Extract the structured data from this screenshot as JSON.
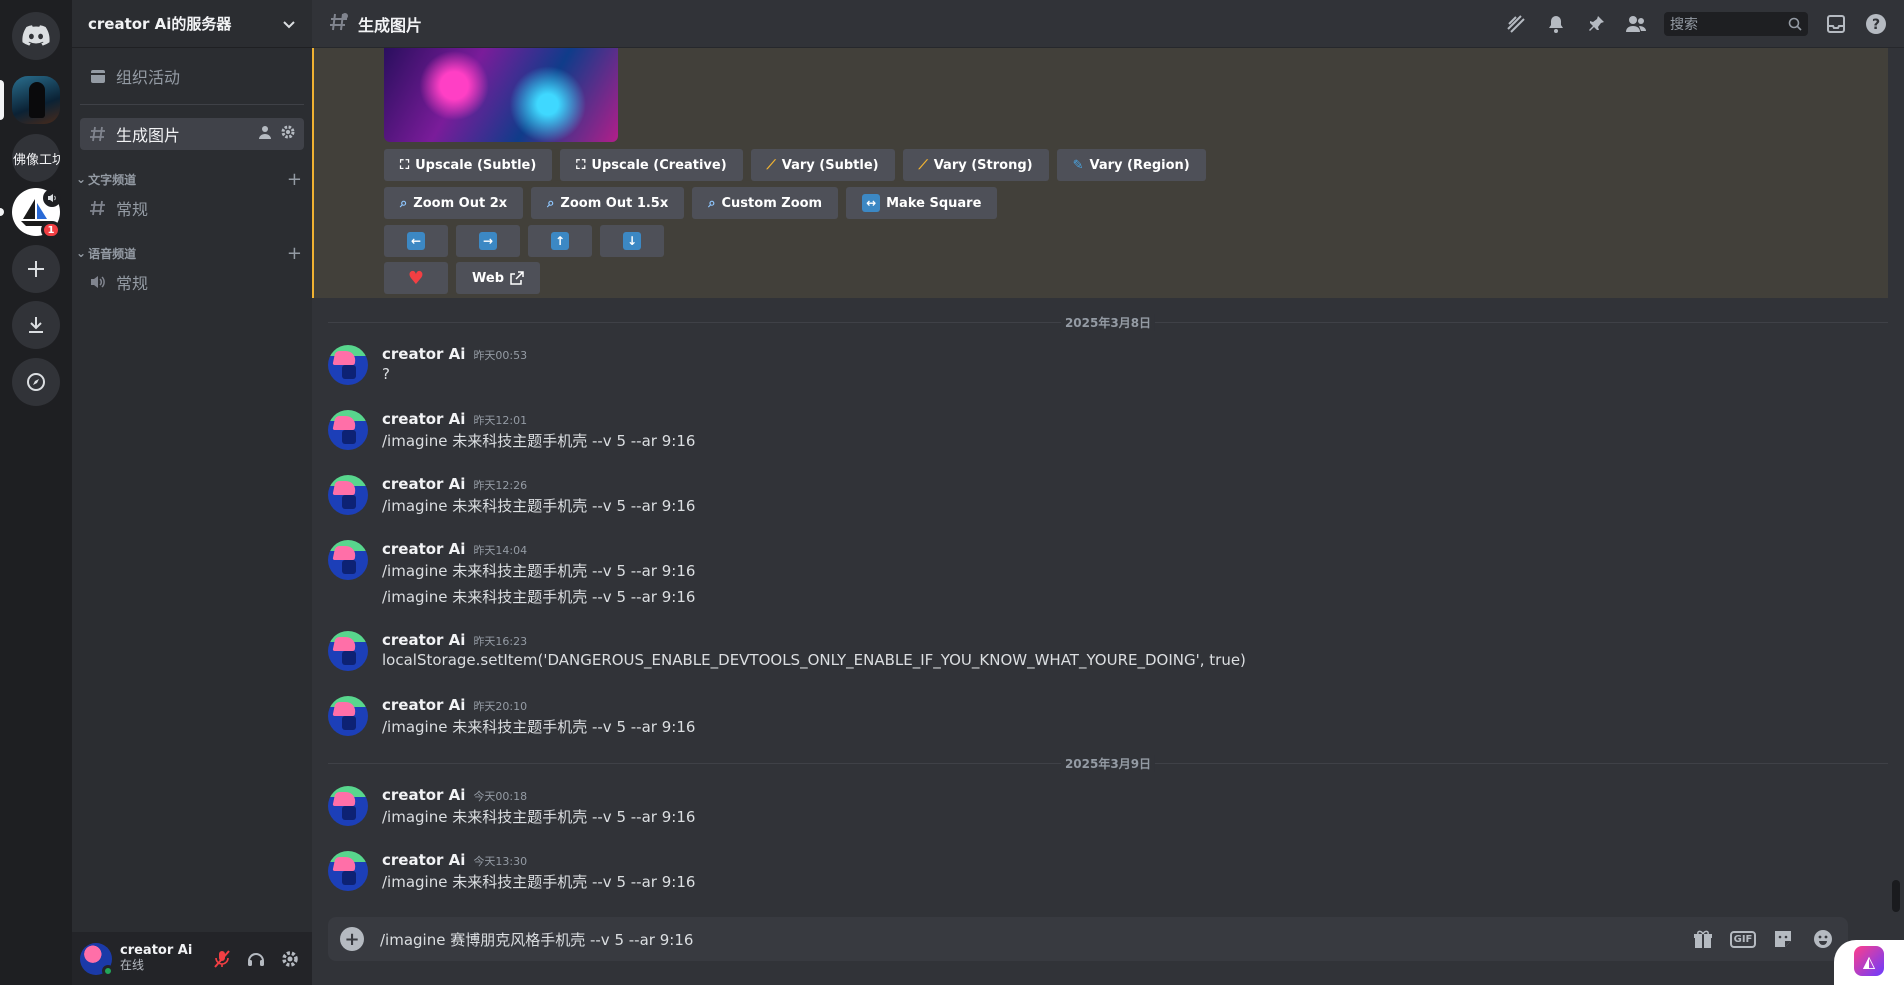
{
  "server_rail": {
    "text_server_label": "佛像工坊",
    "boat_badge_count": "1"
  },
  "sidebar": {
    "guild_name": "creator Ai的服务器",
    "events_label": "组织活动",
    "active_channel": "生成图片",
    "text_category": "文字频道",
    "text_channel": "常规",
    "voice_category": "语音频道",
    "voice_channel": "常规"
  },
  "user_panel": {
    "name": "creator Ai",
    "status": "在线"
  },
  "topbar": {
    "channel_title": "生成图片",
    "search_placeholder": "搜索"
  },
  "component_buttons": {
    "row1": [
      "Upscale (Subtle)",
      "Upscale (Creative)",
      "Vary (Subtle)",
      "Vary (Strong)",
      "Vary (Region)"
    ],
    "row2": [
      "Zoom Out 2x",
      "Zoom Out 1.5x",
      "Custom Zoom",
      "Make Square"
    ],
    "web_label": "Web"
  },
  "date_dividers": [
    "2025年3月8日",
    "2025年3月9日"
  ],
  "messages": [
    {
      "author": "creator Ai",
      "time": "昨天00:53",
      "lines": [
        "?"
      ]
    },
    {
      "author": "creator Ai",
      "time": "昨天12:01",
      "lines": [
        "/imagine 未来科技主题手机壳 --v 5 --ar 9:16"
      ]
    },
    {
      "author": "creator Ai",
      "time": "昨天12:26",
      "lines": [
        "/imagine 未来科技主题手机壳 --v 5 --ar 9:16"
      ]
    },
    {
      "author": "creator Ai",
      "time": "昨天14:04",
      "lines": [
        "/imagine 未来科技主题手机壳 --v 5 --ar 9:16",
        "/imagine 未来科技主题手机壳 --v 5 --ar 9:16"
      ]
    },
    {
      "author": "creator Ai",
      "time": "昨天16:23",
      "lines": [
        "localStorage.setItem('DANGEROUS_ENABLE_DEVTOOLS_ONLY_ENABLE_IF_YOU_KNOW_WHAT_YOURE_DOING', true)"
      ]
    },
    {
      "author": "creator Ai",
      "time": "昨天20:10",
      "lines": [
        "/imagine 未来科技主题手机壳 --v 5 --ar 9:16"
      ]
    },
    {
      "author": "creator Ai",
      "time": "今天00:18",
      "lines": [
        "/imagine 未来科技主题手机壳 --v 5 --ar 9:16"
      ]
    },
    {
      "author": "creator Ai",
      "time": "今天13:30",
      "lines": [
        "/imagine 未来科技主题手机壳 --v 5 --ar 9:16"
      ]
    }
  ],
  "composer": {
    "value": "/imagine 赛博朋克风格手机壳 --v 5 --ar 9:16",
    "gif_label": "GIF"
  }
}
